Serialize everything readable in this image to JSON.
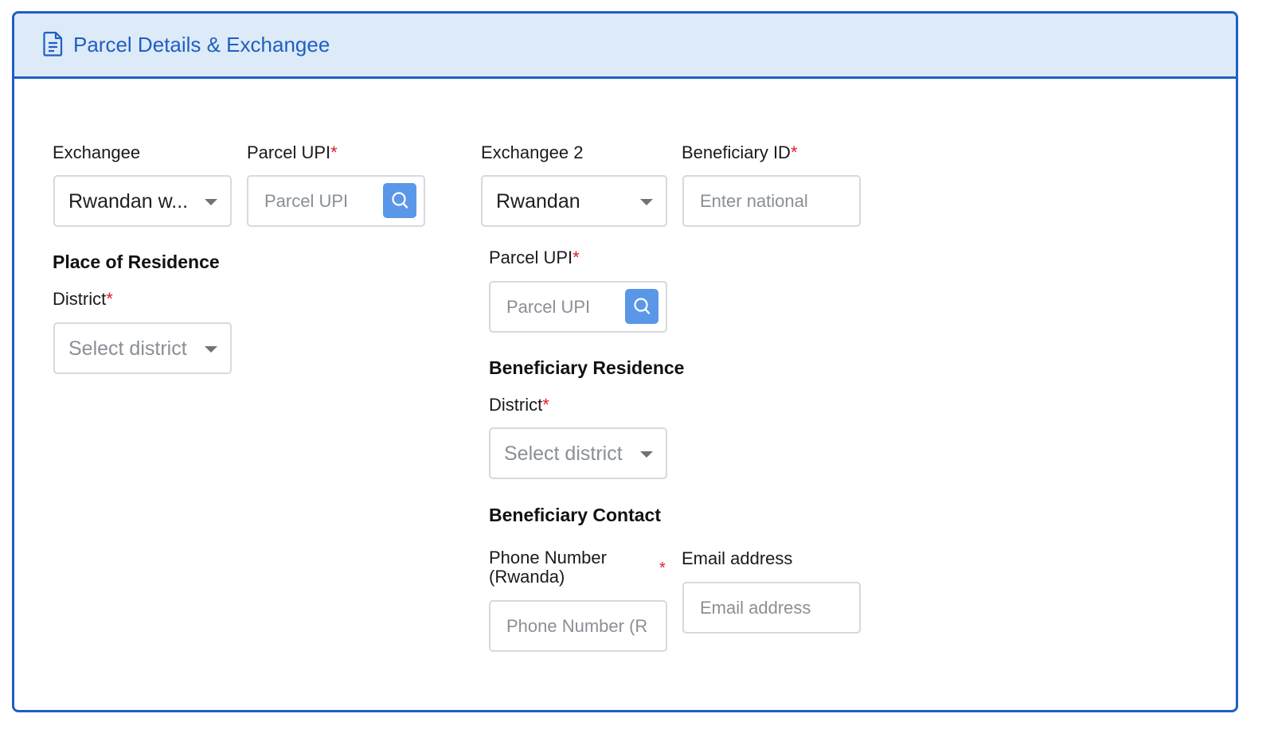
{
  "header": {
    "title": "Parcel Details & Exchangee",
    "icon": "document-icon"
  },
  "left": {
    "exchangee": {
      "label": "Exchangee",
      "value": "Rwandan w..."
    },
    "parcel_upi": {
      "label": "Parcel UPI",
      "required_mark": "*",
      "placeholder": "Parcel UPI"
    },
    "place_of_residence": {
      "title": "Place of Residence",
      "district_label": "District",
      "required_mark": "*",
      "district_placeholder": "Select district"
    }
  },
  "right": {
    "exchangee2": {
      "label": "Exchangee 2",
      "value": "Rwandan"
    },
    "beneficiary_id": {
      "label": "Beneficiary ID",
      "required_mark": "*",
      "placeholder": "Enter national"
    },
    "parcel_upi": {
      "label": "Parcel UPI",
      "required_mark": "*",
      "placeholder": "Parcel UPI"
    },
    "beneficiary_residence": {
      "title": "Beneficiary Residence",
      "district_label": "District",
      "required_mark": "*",
      "district_placeholder": "Select district"
    },
    "beneficiary_contact": {
      "title": "Beneficiary Contact",
      "phone_label_line1": "Phone Number",
      "phone_label_line2": "(Rwanda)",
      "phone_required_mark": "*",
      "phone_placeholder": "Phone Number (R",
      "email_label": "Email address",
      "email_placeholder": "Email address"
    }
  },
  "colors": {
    "accent": "#1f5fc4",
    "header_bg": "#ddeaf7",
    "search_button": "#5b97e8",
    "required": "#e0192a"
  }
}
